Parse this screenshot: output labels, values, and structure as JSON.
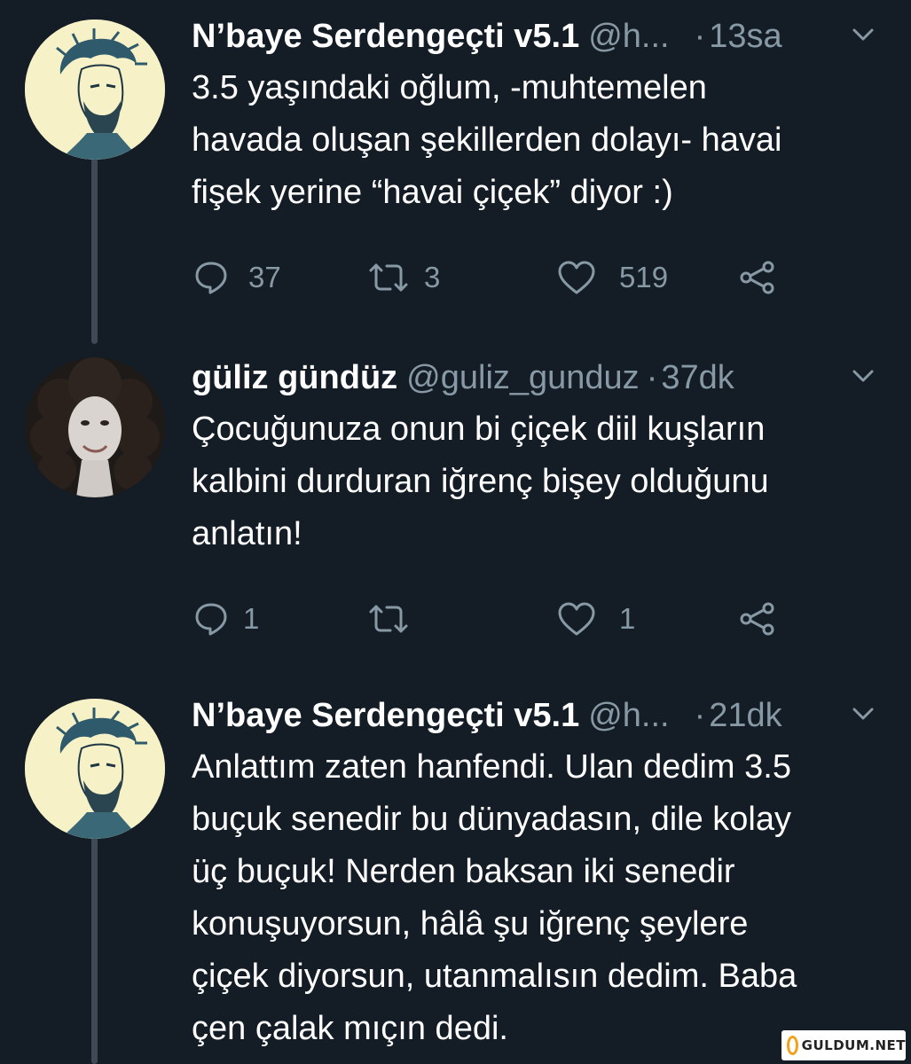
{
  "thread": {
    "tweets": [
      {
        "name": "N’baye Serdengeçti v5.1",
        "handle": "@h...",
        "separator": "·",
        "time": "13sa",
        "avatar_icon": "bearded-man-illustration",
        "text_lines": [
          "3.5 yaşındaki oğlum, -muhtemelen",
          "havada oluşan şekillerden dolayı- havai",
          "fişek yerine “havai çiçek” diyor :)"
        ],
        "actions": {
          "reply_count": "37",
          "retweet_count": "3",
          "like_count": "519"
        }
      },
      {
        "name": "güliz gündüz",
        "handle": "@guliz_gunduz",
        "separator": "·",
        "time": "37dk",
        "avatar_icon": "woman-curly-hair-photo",
        "text_lines": [
          "Çocuğunuza onun bi çiçek diil kuşların",
          "kalbini durduran iğrenç bişey olduğunu",
          "anlatın!"
        ],
        "actions": {
          "reply_count": "1",
          "retweet_count": "",
          "like_count": "1"
        }
      },
      {
        "name": "N’baye Serdengeçti v5.1",
        "handle": "@h...",
        "separator": "·",
        "time": "21dk",
        "avatar_icon": "bearded-man-illustration",
        "text_lines": [
          "Anlattım zaten hanfendi. Ulan dedim 3.5",
          "buçuk senedir bu dünyadasın, dile kolay",
          "üç buçuk! Nerden baksan iki senedir",
          "konuşuyorsun, hâlâ şu iğrenç şeylere",
          "çiçek diyorsun, utanmalısın dedim. Baba",
          "çen çalak mıçın dedi."
        ]
      }
    ]
  },
  "icons": {
    "reply": "speech-bubble-icon",
    "retweet": "retweet-arrows-icon",
    "like": "heart-outline-icon",
    "share": "share-nodes-icon",
    "more": "chevron-down-icon"
  },
  "colors": {
    "background": "#141d26",
    "text": "#ffffff",
    "secondary": "#8899a6",
    "thread_line": "#3f4a56"
  },
  "watermark": {
    "text": "GULDUM.NET"
  }
}
